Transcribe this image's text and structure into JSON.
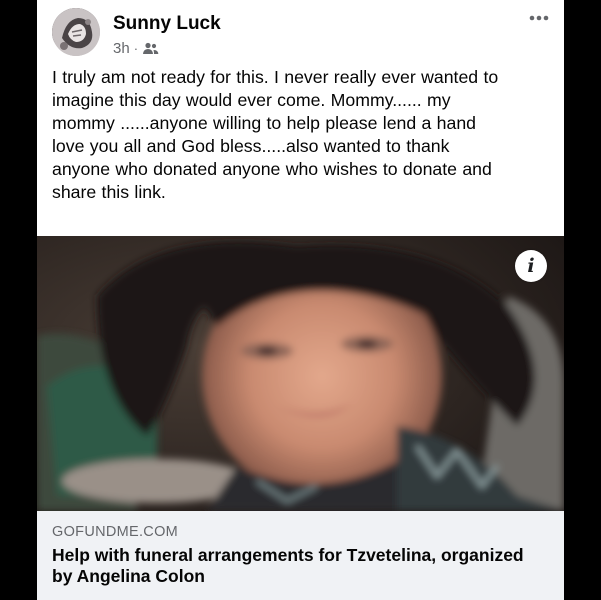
{
  "post": {
    "author": "Sunny Luck",
    "time": "3h",
    "separator": "·",
    "audience_icon": "friends-icon",
    "more_icon": "more-options-icon",
    "text": "I truly am not ready for this. I never really ever wanted to\nimagine this day would ever come. Mommy...... my\nmommy ......anyone willing to help please lend a hand\nlove you all and God bless.....also wanted to thank\nanyone who donated anyone who wishes to donate and\nshare this link."
  },
  "link_preview": {
    "info_label": "i",
    "domain": "GOFUNDME.COM",
    "title": "Help with funeral arrangements for Tzvetelina, organized\nby Angelina Colon"
  },
  "colors": {
    "background": "#000000",
    "card": "#ffffff",
    "footer": "#f0f2f5",
    "text_primary": "#050505",
    "text_secondary": "#65676b"
  }
}
